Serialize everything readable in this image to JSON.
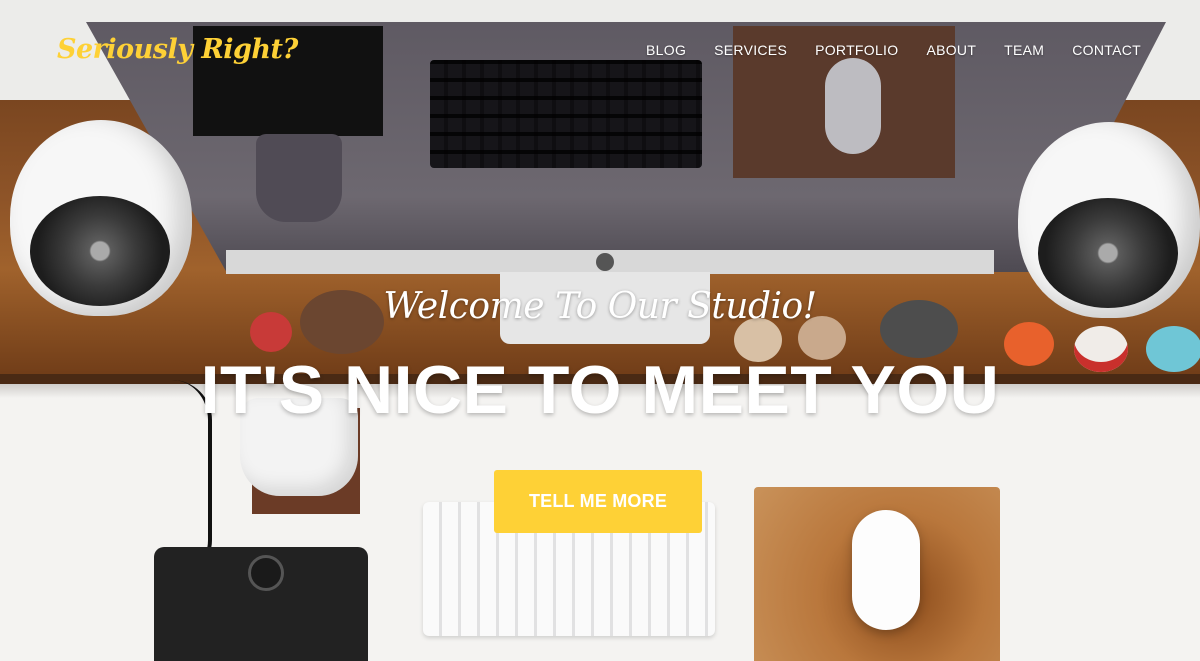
{
  "brand": {
    "name": "Seriously Right?"
  },
  "nav": {
    "items": [
      {
        "label": "BLOG"
      },
      {
        "label": "SERVICES"
      },
      {
        "label": "PORTFOLIO"
      },
      {
        "label": "ABOUT"
      },
      {
        "label": "TEAM"
      },
      {
        "label": "CONTACT"
      }
    ]
  },
  "hero": {
    "lead_in": "Welcome To Our Studio!",
    "heading": "IT'S NICE TO MEET YOU",
    "cta_label": "TELL ME MORE"
  },
  "colors": {
    "accent": "#fed136",
    "text_light": "#ffffff"
  }
}
